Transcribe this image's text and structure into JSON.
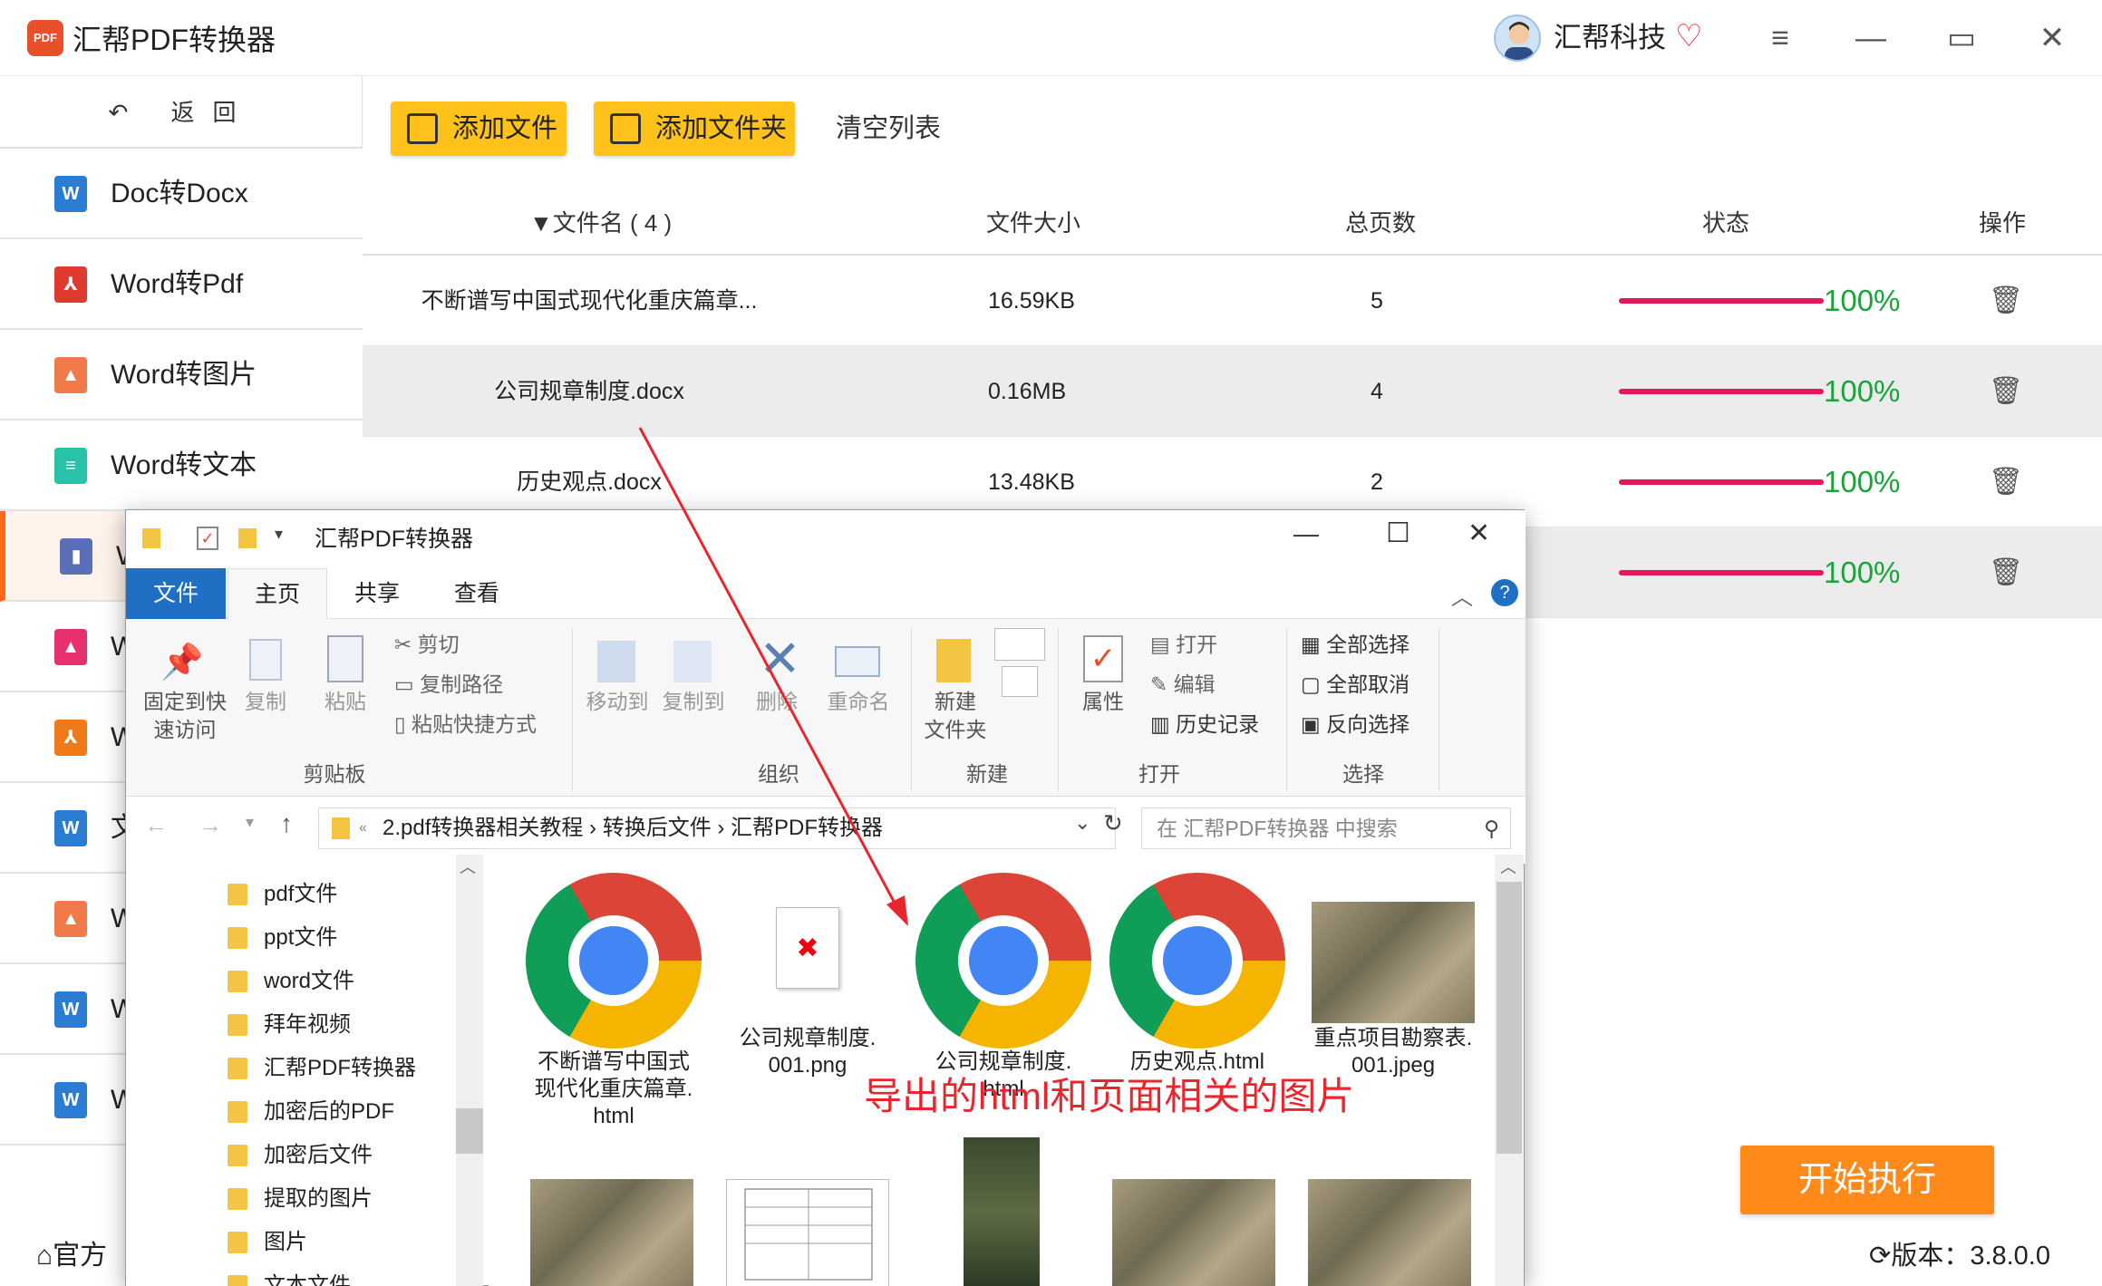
{
  "app": {
    "title": "汇帮PDF转换器",
    "logo_text": "PDF",
    "user": "汇帮科技"
  },
  "sidebar": {
    "back_label": "返回",
    "items": [
      {
        "label": "Doc转Docx",
        "icon": "word-icon",
        "color": "#2b7cd3"
      },
      {
        "label": "Word转Pdf",
        "icon": "pdf-icon",
        "color": "#e03a2f"
      },
      {
        "label": "Word转图片",
        "icon": "image-icon",
        "color": "#f07a4a"
      },
      {
        "label": "Word转文本",
        "icon": "text-icon",
        "color": "#27c2a8"
      },
      {
        "label": "W",
        "icon": "html-icon",
        "color": "#5b6fb8"
      },
      {
        "label": "W",
        "icon": "image-icon",
        "color": "#e8306d"
      },
      {
        "label": "W",
        "icon": "pdf-icon",
        "color": "#f07a1a"
      },
      {
        "label": "文",
        "icon": "word-icon",
        "color": "#2b7cd3"
      },
      {
        "label": "W",
        "icon": "image-icon",
        "color": "#f07a4a"
      },
      {
        "label": "W",
        "icon": "word-icon",
        "color": "#2b7cd3"
      },
      {
        "label": "W",
        "icon": "word-icon",
        "color": "#2b7cd3"
      }
    ]
  },
  "toolbar": {
    "add_file": "添加文件",
    "add_folder": "添加文件夹",
    "clear": "清空列表"
  },
  "table": {
    "headers": {
      "name": "▼文件名 ( 4 )",
      "size": "文件大小",
      "pages": "总页数",
      "status": "状态",
      "action": "操作"
    },
    "rows": [
      {
        "name": "不断谱写中国式现代化重庆篇章...",
        "size": "16.59KB",
        "pages": "5",
        "progress": "100%"
      },
      {
        "name": "公司规章制度.docx",
        "size": "0.16MB",
        "pages": "4",
        "progress": "100%"
      },
      {
        "name": "历史观点.docx",
        "size": "13.48KB",
        "pages": "2",
        "progress": "100%"
      },
      {
        "name": "",
        "size": "",
        "pages": "",
        "progress": "100%"
      }
    ]
  },
  "start_button": "开始执行",
  "footer": {
    "official": "官方",
    "version": "版本：3.8.0.0"
  },
  "explorer": {
    "title": "汇帮PDF转换器",
    "tabs": {
      "file": "文件",
      "home": "主页",
      "share": "共享",
      "view": "查看"
    },
    "ribbon": {
      "pin_l1": "固定到快",
      "pin_l2": "速访问",
      "copy": "复制",
      "paste": "粘贴",
      "cut": "剪切",
      "copy_path": "复制路径",
      "paste_shortcut": "粘贴快捷方式",
      "move_to": "移动到",
      "copy_to": "复制到",
      "delete": "删除",
      "rename": "重命名",
      "new_folder_l1": "新建",
      "new_folder_l2": "文件夹",
      "properties": "属性",
      "open": "打开",
      "edit": "编辑",
      "history": "历史记录",
      "select_all": "全部选择",
      "select_none": "全部取消",
      "invert": "反向选择",
      "grp_clipboard": "剪贴板",
      "grp_organize": "组织",
      "grp_new": "新建",
      "grp_open": "打开",
      "grp_select": "选择"
    },
    "address": {
      "path1": "2.pdf转换器相关教程",
      "path2": "转换后文件",
      "path3": "汇帮PDF转换器",
      "search_placeholder": "在 汇帮PDF转换器 中搜索"
    },
    "tree": [
      "pdf文件",
      "ppt文件",
      "word文件",
      "拜年视频",
      "汇帮PDF转换器",
      "加密后的PDF",
      "加密后文件",
      "提取的图片",
      "图片",
      "文本文件"
    ],
    "files": [
      {
        "l1": "不断谱写中国式",
        "l2": "现代化重庆篇章.",
        "l3": "html"
      },
      {
        "l1": "公司规章制度.",
        "l2": "001.png",
        "l3": ""
      },
      {
        "l1": "公司规章制度.",
        "l2": "html",
        "l3": ""
      },
      {
        "l1": "历史观点.html",
        "l2": "",
        "l3": ""
      },
      {
        "l1": "重点项目勘察表.",
        "l2": "001.jpeg",
        "l3": ""
      }
    ]
  },
  "annotation": "导出的html和页面相关的图片"
}
